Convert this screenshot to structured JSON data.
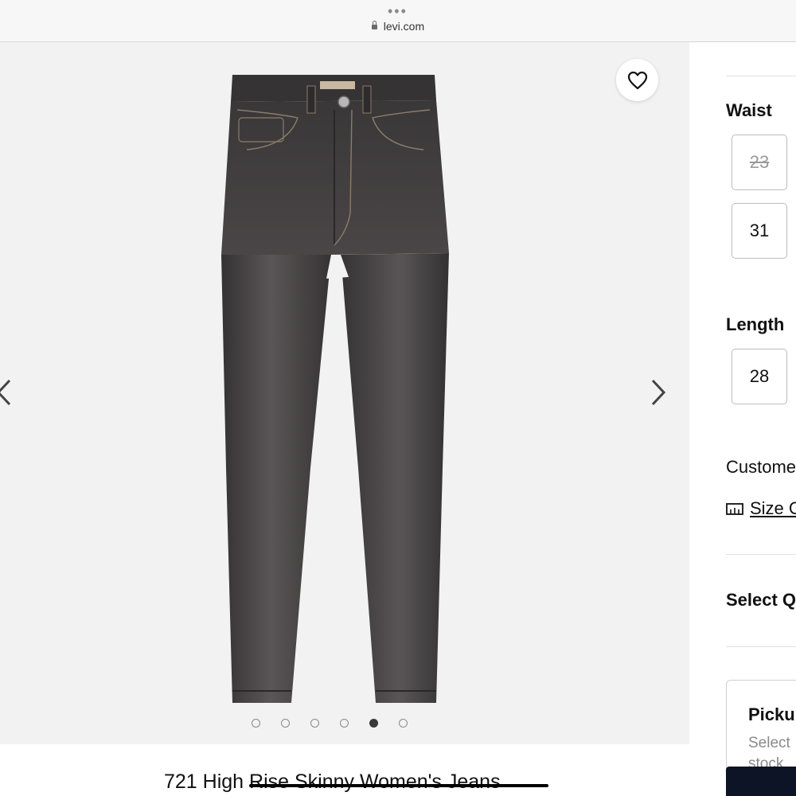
{
  "browser": {
    "tab_dots": "•••",
    "url": "levi.com"
  },
  "gallery": {
    "dot_count": 6,
    "active_dot_index": 4,
    "icons": {
      "favorite": "heart-icon",
      "prev": "chevron-left-icon",
      "next": "chevron-right-icon"
    }
  },
  "product": {
    "title": "721 High Rise Skinny Women's Jeans"
  },
  "options": {
    "waist_label": "Waist",
    "waist_sizes": [
      {
        "value": "23",
        "available": false
      },
      {
        "value": "31",
        "available": true
      }
    ],
    "length_label": "Length",
    "length_sizes": [
      {
        "value": "28",
        "available": true
      }
    ],
    "customer_text": "Custome",
    "size_guide_label": "Size G",
    "select_qty_label": "Select Q"
  },
  "pickup": {
    "title": "Picku",
    "sub_line1": "Select",
    "sub_line2": "stock"
  },
  "colors": {
    "denim": "#3f3c3d",
    "gallery_bg": "#f2f2f3",
    "button_dark": "#0d1426"
  }
}
